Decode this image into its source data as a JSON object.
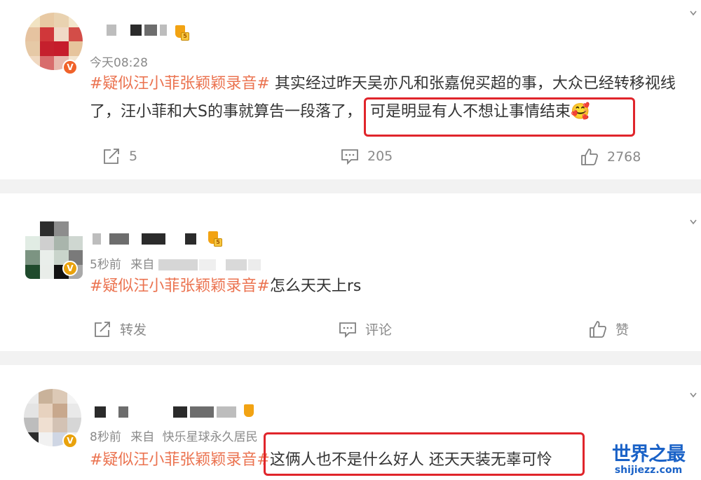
{
  "posts": [
    {
      "time": "今天08:28",
      "tag": "#疑似汪小菲张颖颖录音#",
      "line1_rest": "其实经过昨天吴亦凡和张嘉倪买超的事，大众已经转移视线",
      "line2_plain": "了，汪小菲和大S的事就算告一段落了，",
      "line2_highlight": "可是明显有人不想让事情结束",
      "emoji": "🥰",
      "repost": "5",
      "comment": "205",
      "like": "2768"
    },
    {
      "time": "5秒前",
      "source_prefix": "来自",
      "tag": "#疑似汪小菲张颖颖录音#",
      "text": "怎么天天上rs",
      "repost": "转发",
      "comment": "评论",
      "like": "赞"
    },
    {
      "time": "8秒前",
      "source_prefix": "来自",
      "source": "快乐星球永久居民",
      "tag": "#疑似汪小菲张颖颖录音#",
      "highlight": "这俩人也不是什么好人 还天天装无辜可怜"
    }
  ],
  "badges": {
    "verified": "V",
    "level1": "5",
    "level2": "5"
  },
  "watermark": {
    "title": "世界之最",
    "url": "shijiezz.com"
  },
  "icons": [
    "repost-icon",
    "comment-icon",
    "like-icon",
    "verified-badge-icon",
    "level-badge-icon",
    "chevron-down-icon"
  ],
  "colors": {
    "tag": "#eb7350",
    "highlight_border": "#e0252b",
    "watermark": "#1a62c7",
    "verified_gold": "#e9a20c",
    "verified_red": "#f0622a"
  }
}
